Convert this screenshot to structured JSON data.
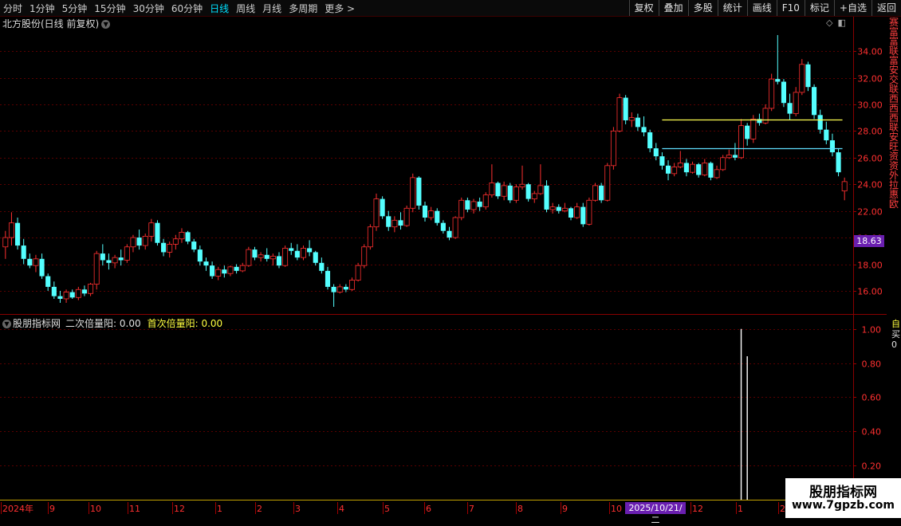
{
  "toolbar": {
    "periods": [
      "分时",
      "1分钟",
      "5分钟",
      "15分钟",
      "30分钟",
      "60分钟",
      "日线",
      "周线",
      "月线",
      "多周期",
      "更多"
    ],
    "active": "日线",
    "right_buttons": [
      "复权",
      "叠加",
      "多股",
      "统计",
      "画线",
      "F10",
      "标记",
      "+自选",
      "返回"
    ]
  },
  "main": {
    "title": "北方股份(日线 前复权)",
    "y_axis": {
      "min": 14.5,
      "max": 35.5,
      "ticks": [
        "16.00",
        "18.00",
        "20.00",
        "22.00",
        "24.00",
        "26.00",
        "28.00",
        "30.00",
        "32.00",
        "34.00"
      ]
    },
    "current_price": "18.63",
    "levels": [
      {
        "name": "upper",
        "price": 28.85,
        "color": "#ffff50"
      },
      {
        "name": "lower",
        "price": 26.7,
        "color": "#60e0ff"
      }
    ],
    "colors": {
      "up": "#ff3030",
      "down": "#54ffff",
      "grid": "#5a0000"
    }
  },
  "indicator": {
    "name": "股朋指标网",
    "series1_label": "二次倍量阳: 0.00",
    "series2_label": "首次倍量阳: 0.00",
    "y_axis": {
      "min": 0,
      "max": 1.05,
      "ticks": [
        "0.20",
        "0.40",
        "0.60",
        "0.80",
        "1.00"
      ]
    },
    "spike_value": 1.0
  },
  "x_axis": {
    "labels": [
      "2024年",
      "9",
      "10",
      "11",
      "12",
      "1",
      "2",
      "3",
      "4",
      "5",
      "6",
      "7",
      "8",
      "9",
      "10",
      "2025/10/21/二",
      "12",
      "1",
      "2"
    ],
    "selected_date": "2025/10/21/二"
  },
  "right_strip": [
    "赛",
    "富",
    "富",
    "联",
    "富",
    "安",
    "交",
    "联",
    "西",
    "西",
    "西",
    "联",
    "安",
    "旺",
    "资",
    "资",
    "外",
    "拉",
    "惠",
    "欧"
  ],
  "right_strip2": [
    "自",
    "买",
    "0"
  ],
  "watermark": {
    "line1": "股朋指标网",
    "line2": "www.7gpzb.com"
  },
  "chart_data": {
    "type": "candlestick",
    "candles": [
      [
        19.3,
        20.5,
        18.4,
        20.0
      ],
      [
        20.0,
        21.9,
        19.4,
        21.1
      ],
      [
        21.1,
        21.5,
        19.1,
        19.4
      ],
      [
        19.4,
        19.9,
        18.0,
        18.4
      ],
      [
        18.4,
        18.8,
        17.7,
        17.9
      ],
      [
        17.9,
        18.7,
        17.4,
        18.4
      ],
      [
        18.4,
        18.8,
        16.9,
        17.1
      ],
      [
        17.1,
        17.3,
        16.0,
        16.3
      ],
      [
        16.3,
        16.7,
        15.4,
        15.6
      ],
      [
        15.6,
        16.0,
        15.1,
        15.4
      ],
      [
        15.4,
        16.1,
        15.1,
        15.9
      ],
      [
        15.9,
        16.1,
        15.4,
        15.5
      ],
      [
        15.5,
        16.3,
        15.3,
        16.1
      ],
      [
        16.1,
        16.4,
        15.6,
        15.8
      ],
      [
        15.8,
        16.6,
        15.6,
        16.5
      ],
      [
        16.5,
        19.0,
        16.1,
        18.8
      ],
      [
        18.8,
        19.5,
        17.9,
        18.3
      ],
      [
        18.3,
        18.8,
        17.6,
        18.1
      ],
      [
        18.1,
        18.7,
        17.7,
        18.5
      ],
      [
        18.5,
        19.1,
        17.9,
        18.3
      ],
      [
        18.3,
        19.5,
        18.1,
        19.3
      ],
      [
        19.3,
        20.2,
        18.9,
        20.0
      ],
      [
        20.0,
        20.6,
        19.1,
        19.4
      ],
      [
        19.4,
        20.3,
        19.1,
        20.1
      ],
      [
        20.1,
        21.4,
        19.7,
        21.1
      ],
      [
        21.1,
        21.3,
        19.4,
        19.6
      ],
      [
        19.6,
        19.9,
        18.6,
        18.9
      ],
      [
        18.9,
        19.7,
        18.5,
        19.5
      ],
      [
        19.5,
        20.2,
        19.1,
        19.9
      ],
      [
        19.9,
        20.7,
        19.6,
        20.4
      ],
      [
        20.4,
        20.5,
        19.5,
        19.7
      ],
      [
        19.7,
        19.9,
        18.9,
        19.1
      ],
      [
        19.1,
        19.4,
        17.9,
        18.2
      ],
      [
        18.2,
        18.5,
        17.5,
        17.9
      ],
      [
        17.9,
        18.2,
        16.9,
        17.1
      ],
      [
        17.1,
        17.8,
        16.8,
        17.6
      ],
      [
        17.6,
        17.9,
        17.0,
        17.3
      ],
      [
        17.3,
        17.9,
        17.1,
        17.8
      ],
      [
        17.8,
        18.0,
        17.3,
        17.5
      ],
      [
        17.5,
        18.1,
        17.4,
        17.9
      ],
      [
        17.9,
        19.3,
        17.8,
        19.1
      ],
      [
        19.1,
        19.3,
        18.3,
        18.5
      ],
      [
        18.5,
        18.9,
        18.2,
        18.7
      ],
      [
        18.7,
        19.2,
        18.2,
        18.4
      ],
      [
        18.4,
        18.8,
        17.9,
        18.6
      ],
      [
        18.6,
        18.9,
        17.7,
        17.9
      ],
      [
        17.9,
        19.4,
        17.8,
        19.2
      ],
      [
        19.2,
        19.6,
        18.7,
        19.0
      ],
      [
        19.0,
        19.5,
        18.3,
        18.5
      ],
      [
        18.5,
        19.4,
        18.3,
        19.2
      ],
      [
        19.2,
        19.8,
        18.6,
        18.9
      ],
      [
        18.9,
        19.0,
        17.9,
        18.1
      ],
      [
        18.1,
        18.5,
        17.3,
        17.5
      ],
      [
        17.5,
        17.8,
        16.1,
        16.3
      ],
      [
        16.3,
        16.5,
        14.8,
        15.9
      ],
      [
        15.9,
        16.5,
        15.8,
        16.3
      ],
      [
        16.3,
        16.5,
        15.9,
        16.1
      ],
      [
        16.1,
        17.0,
        16.0,
        16.8
      ],
      [
        16.8,
        18.1,
        16.7,
        17.9
      ],
      [
        17.9,
        19.5,
        17.7,
        19.3
      ],
      [
        19.3,
        21.0,
        19.1,
        20.8
      ],
      [
        20.8,
        23.3,
        20.5,
        22.9
      ],
      [
        22.9,
        23.1,
        21.4,
        21.6
      ],
      [
        21.6,
        22.0,
        20.5,
        20.8
      ],
      [
        20.8,
        21.6,
        20.4,
        21.3
      ],
      [
        21.3,
        21.9,
        20.6,
        20.9
      ],
      [
        20.9,
        22.4,
        20.8,
        22.2
      ],
      [
        22.2,
        24.8,
        21.9,
        24.5
      ],
      [
        24.5,
        24.6,
        22.1,
        22.4
      ],
      [
        22.4,
        22.7,
        21.2,
        21.5
      ],
      [
        21.5,
        22.3,
        21.3,
        22.0
      ],
      [
        22.0,
        22.2,
        20.9,
        21.1
      ],
      [
        21.1,
        21.3,
        20.3,
        20.5
      ],
      [
        20.5,
        20.8,
        19.8,
        20.0
      ],
      [
        20.0,
        21.6,
        19.9,
        21.5
      ],
      [
        21.5,
        23.0,
        21.3,
        22.8
      ],
      [
        22.8,
        23.0,
        21.9,
        22.1
      ],
      [
        22.1,
        22.9,
        21.8,
        22.7
      ],
      [
        22.7,
        23.0,
        22.0,
        22.3
      ],
      [
        22.3,
        23.4,
        22.1,
        23.2
      ],
      [
        23.2,
        25.5,
        23.0,
        24.1
      ],
      [
        24.1,
        24.2,
        22.9,
        23.1
      ],
      [
        23.1,
        24.2,
        22.8,
        23.9
      ],
      [
        23.9,
        24.1,
        22.6,
        22.8
      ],
      [
        22.8,
        24.0,
        22.6,
        23.8
      ],
      [
        23.8,
        25.4,
        23.6,
        24.0
      ],
      [
        24.0,
        24.1,
        22.7,
        22.9
      ],
      [
        22.9,
        23.5,
        22.6,
        23.3
      ],
      [
        23.3,
        25.5,
        23.2,
        23.9
      ],
      [
        23.9,
        24.3,
        21.9,
        22.1
      ],
      [
        22.1,
        22.6,
        21.8,
        22.3
      ],
      [
        22.3,
        22.5,
        21.8,
        22.0
      ],
      [
        22.0,
        22.6,
        21.9,
        22.2
      ],
      [
        22.2,
        22.3,
        21.3,
        21.5
      ],
      [
        21.5,
        22.6,
        21.4,
        22.3
      ],
      [
        22.3,
        22.6,
        20.8,
        21.0
      ],
      [
        21.0,
        23.0,
        20.9,
        22.8
      ],
      [
        22.8,
        24.1,
        22.7,
        23.9
      ],
      [
        23.9,
        24.1,
        22.6,
        22.8
      ],
      [
        22.8,
        25.6,
        22.7,
        25.4
      ],
      [
        25.4,
        28.3,
        25.1,
        28.0
      ],
      [
        28.0,
        30.8,
        27.9,
        30.5
      ],
      [
        30.5,
        30.7,
        28.5,
        28.8
      ],
      [
        28.8,
        29.4,
        28.3,
        29.0
      ],
      [
        29.0,
        29.3,
        28.0,
        28.3
      ],
      [
        28.3,
        29.1,
        27.6,
        27.9
      ],
      [
        27.9,
        28.1,
        26.4,
        26.7
      ],
      [
        26.7,
        27.1,
        25.8,
        26.1
      ],
      [
        26.1,
        26.4,
        25.1,
        25.4
      ],
      [
        25.4,
        25.8,
        24.3,
        24.8
      ],
      [
        24.8,
        25.6,
        24.6,
        25.3
      ],
      [
        25.3,
        26.5,
        25.2,
        25.6
      ],
      [
        25.6,
        25.9,
        24.6,
        24.9
      ],
      [
        24.9,
        25.7,
        24.8,
        25.5
      ],
      [
        25.5,
        25.6,
        24.5,
        24.7
      ],
      [
        24.7,
        25.9,
        24.6,
        25.6
      ],
      [
        25.6,
        25.7,
        24.3,
        24.5
      ],
      [
        24.5,
        25.4,
        24.4,
        25.1
      ],
      [
        25.1,
        26.2,
        25.0,
        26.0
      ],
      [
        26.0,
        26.6,
        25.9,
        26.2
      ],
      [
        26.2,
        27.1,
        25.8,
        26.0
      ],
      [
        26.0,
        28.9,
        25.9,
        28.4
      ],
      [
        28.4,
        28.6,
        26.9,
        27.4
      ],
      [
        27.4,
        29.2,
        27.1,
        28.9
      ],
      [
        28.9,
        29.3,
        28.4,
        28.6
      ],
      [
        28.6,
        30.0,
        28.5,
        29.7
      ],
      [
        29.7,
        32.3,
        29.5,
        31.9
      ],
      [
        31.9,
        35.2,
        31.5,
        31.7
      ],
      [
        31.7,
        31.9,
        29.8,
        30.1
      ],
      [
        30.1,
        30.8,
        28.8,
        29.3
      ],
      [
        29.3,
        31.3,
        29.1,
        30.9
      ],
      [
        30.9,
        33.4,
        30.7,
        33.0
      ],
      [
        33.0,
        33.2,
        31.0,
        31.3
      ],
      [
        31.3,
        31.5,
        28.9,
        29.2
      ],
      [
        29.2,
        29.6,
        27.8,
        28.1
      ],
      [
        28.1,
        28.7,
        27.0,
        27.3
      ],
      [
        27.3,
        27.8,
        26.1,
        26.4
      ],
      [
        26.4,
        26.7,
        24.6,
        24.9
      ],
      [
        23.5,
        24.5,
        22.8,
        24.2
      ]
    ],
    "indicator_spikes": [
      {
        "index": 121,
        "value": 1.0
      },
      {
        "index": 122,
        "value": 0.84
      }
    ]
  }
}
